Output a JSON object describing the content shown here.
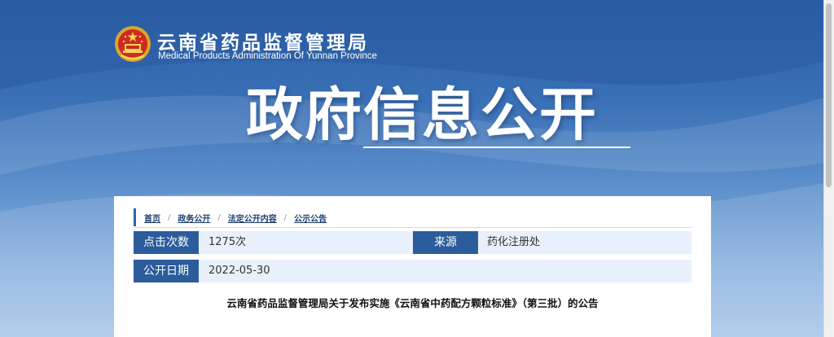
{
  "header": {
    "site_title_cn": "云南省药品监督管理局",
    "site_title_en": "Medical Products Administration Of Yunnan Province",
    "logo_icon": "national-emblem-icon"
  },
  "hero": {
    "title": "政府信息公开"
  },
  "breadcrumb": {
    "items": [
      "首页",
      "政务公开",
      "法定公开内容",
      "公示公告"
    ],
    "separator": "/"
  },
  "info": {
    "clicks_label": "点击次数",
    "clicks_value": "1275次",
    "source_label": "来源",
    "source_value": "药化注册处",
    "date_label": "公开日期",
    "date_value": "2022-05-30"
  },
  "document": {
    "title": "云南省药品监督管理局关于发布实施《云南省中药配方颗粒标准》（第三批）的公告"
  },
  "colors": {
    "label_bg": "#2b5c9b",
    "row_bg": "#e8f1fb",
    "breadcrumb_accent": "#2a64ad"
  }
}
